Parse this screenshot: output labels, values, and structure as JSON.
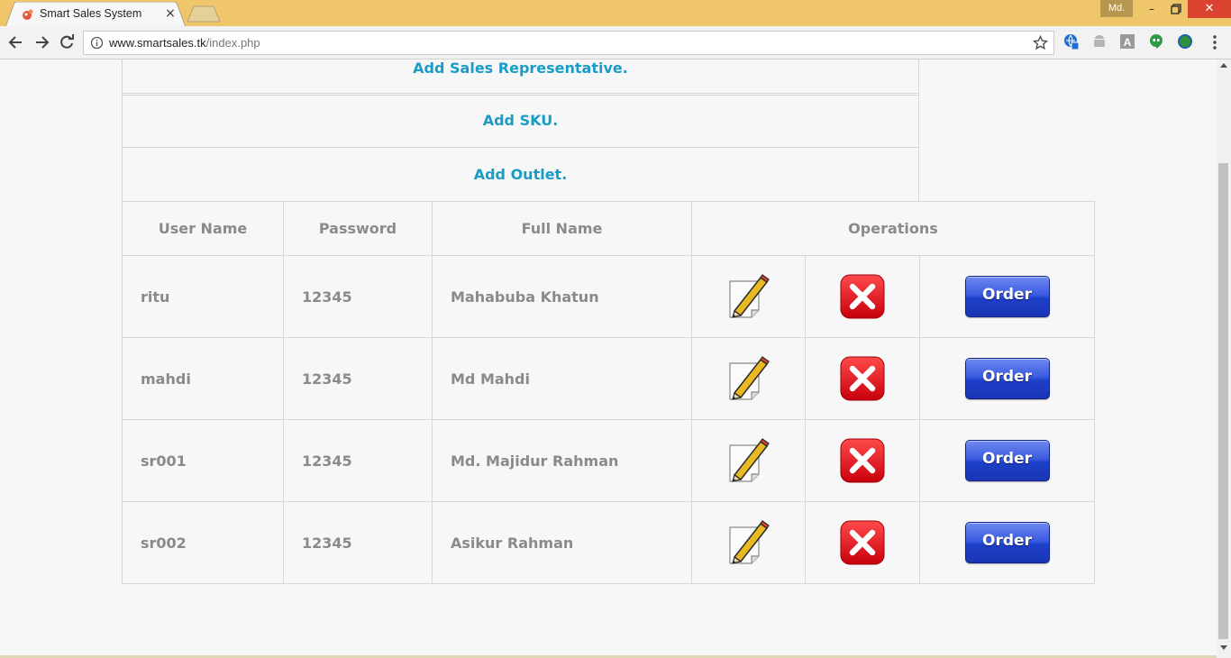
{
  "browser": {
    "tab_title": "Smart Sales System",
    "tab_close_glyph": "×",
    "profile_name": "Md.",
    "window_min": "–",
    "window_close": "✕",
    "url_host": "www.smartsales.tk",
    "url_path": "/index.php",
    "titlebar_color": "#f0c66b",
    "extension_icons": [
      "translate-icon",
      "android-icon",
      "font-a-icon",
      "hangouts-icon",
      "globe-icon"
    ]
  },
  "admin_links": [
    "Add Sales Representative.",
    "Add SKU.",
    "Add Outlet."
  ],
  "table": {
    "headers": {
      "user_name": "User Name",
      "password": "Password",
      "full_name": "Full Name",
      "operations": "Operations"
    },
    "order_label": "Order",
    "rows": [
      {
        "user_name": "ritu",
        "password": "12345",
        "full_name": "Mahabuba Khatun"
      },
      {
        "user_name": "mahdi",
        "password": "12345",
        "full_name": "Md Mahdi"
      },
      {
        "user_name": "sr001",
        "password": "12345",
        "full_name": "Md. Majidur Rahman"
      },
      {
        "user_name": "sr002",
        "password": "12345",
        "full_name": "Asikur Rahman"
      }
    ]
  },
  "colors": {
    "link": "#1a9cc7",
    "header_text": "#8a8a8a",
    "order_button": "#2a4ad6",
    "delete_button": "#e0141e"
  }
}
